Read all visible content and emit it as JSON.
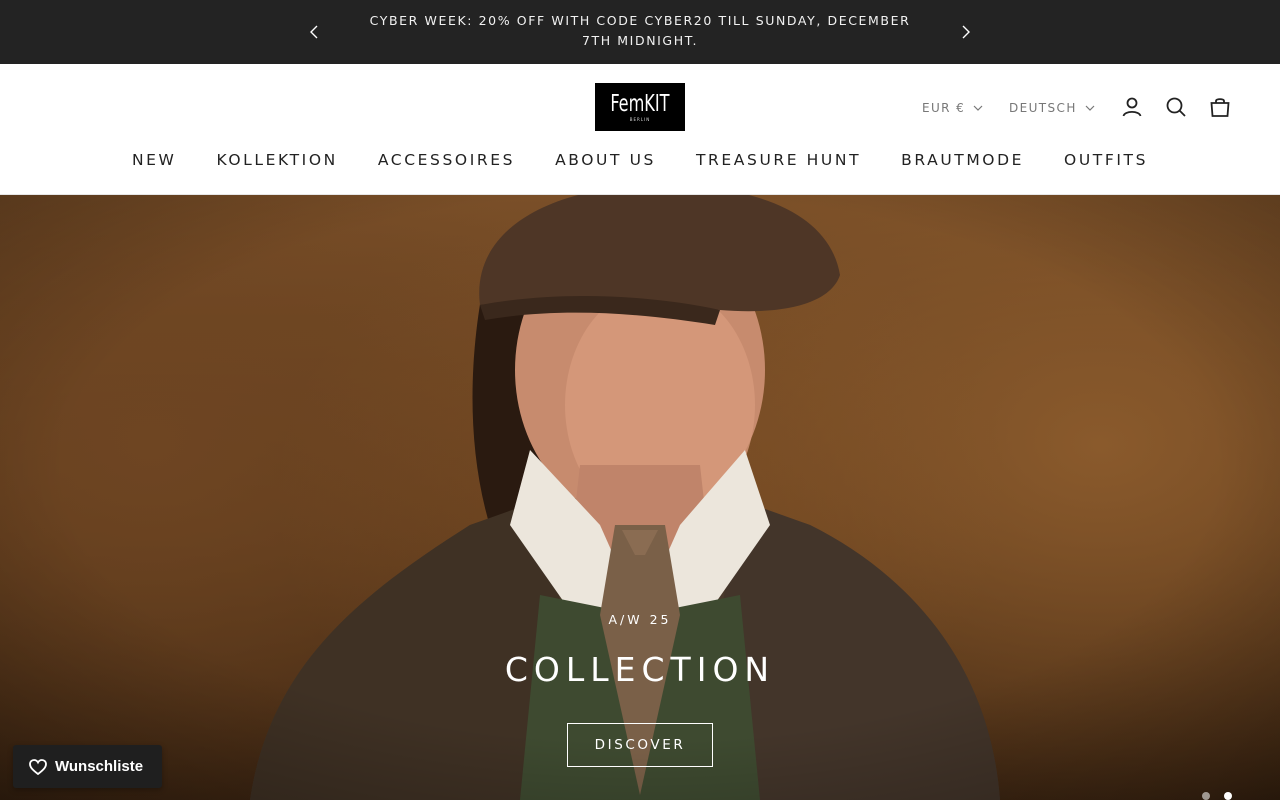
{
  "announcement": {
    "text": "CYBER WEEK: 20% OFF WITH CODE CYBER20 TILL SUNDAY, DECEMBER 7TH MIDNIGHT.",
    "prev_icon": "chevron-left-icon",
    "next_icon": "chevron-right-icon"
  },
  "header": {
    "logo": {
      "brand": "FemKIT",
      "city": "BERLIN"
    },
    "currency": "EUR €",
    "language": "DEUTSCH",
    "icons": [
      "user-icon",
      "search-icon",
      "bag-icon"
    ]
  },
  "nav": {
    "items": [
      {
        "label": "NEW"
      },
      {
        "label": "KOLLEKTION"
      },
      {
        "label": "ACCESSOIRES"
      },
      {
        "label": "ABOUT US"
      },
      {
        "label": "TREASURE HUNT"
      },
      {
        "label": "BRAUTMODE"
      },
      {
        "label": "OUTFITS"
      }
    ]
  },
  "hero": {
    "subheading": "A/W 25",
    "heading": "COLLECTION",
    "button": "DISCOVER",
    "slides_total": 2,
    "active_slide": 2
  },
  "wishlist": {
    "label": "Wunschliste",
    "icon": "heart-icon"
  },
  "colors": {
    "announcement_bg": "#232323",
    "header_bg": "#ffffff",
    "nav_text": "#222222",
    "hero_tone": "#6e4522"
  }
}
